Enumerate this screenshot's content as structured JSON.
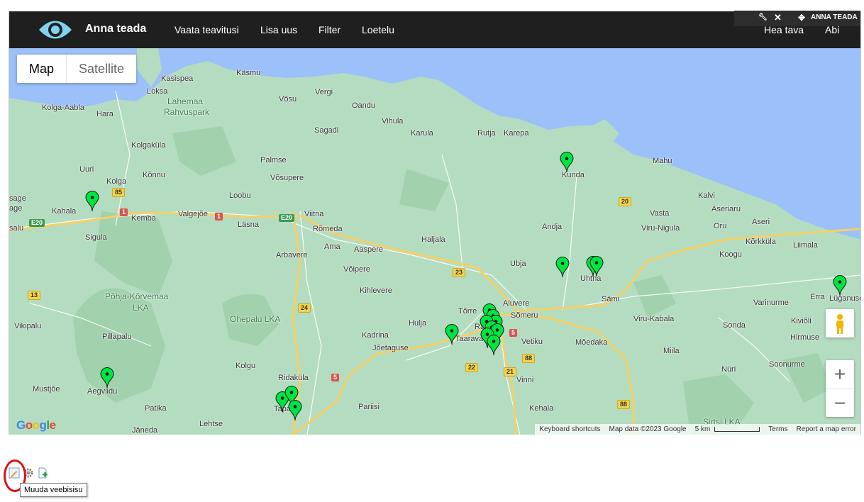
{
  "header": {
    "brand": "Anna teada",
    "nav": [
      "Vaata teavitusi",
      "Lisa uus",
      "Filter",
      "Loetelu"
    ],
    "nav_right": [
      "Hea tava",
      "Abi"
    ],
    "admin_label": "ANNA TEADA"
  },
  "map": {
    "type_map": "Map",
    "type_satellite": "Satellite",
    "places": [
      "Käsmu",
      "Kasispea",
      "Loksa",
      "Lahemaa",
      "Rahvuspark",
      "Vergi",
      "Võsu",
      "Oandu",
      "Kolga-Aabla",
      "Hara",
      "Vihula",
      "Sagadi",
      "Karula",
      "Rutja",
      "Karepa",
      "Kolgaküla",
      "Uuri",
      "Kõnnu",
      "Palmse",
      "Kunda",
      "Mahu",
      "Kolga",
      "Võsupere",
      "Loobu",
      "Kalvi",
      "Kahala",
      "Kemba",
      "Valgejõe",
      "Viitna",
      "Vasta",
      "Aseriaru",
      "Läsna",
      "Rõmeda",
      "Andja",
      "Viru-Nigula",
      "Oru",
      "Aseri",
      "Sigula",
      "Haljala",
      "Arbavere",
      "Ama",
      "Aaspere",
      "Kõrkküla",
      "Liimala",
      "Koogu",
      "Ubja",
      "Uhtna",
      "Võipere",
      "Põhja-Kõrvemaa",
      "LKA",
      "Kihlevere",
      "Sämi",
      "Ohepalu LKA",
      "Aluvere",
      "Erra",
      "Lüganuse",
      "Varinurme",
      "Tõrre",
      "Sõmeru",
      "Viru-Kabala",
      "Kiviõli",
      "Vikipalu",
      "Hulja",
      "Rakvere",
      "Sonda",
      "Kadrina",
      "Taarava",
      "Vetiku",
      "Mõedaka",
      "Hirmuse",
      "Pillapalu",
      "Jõetaguse",
      "Miila",
      "Kolgu",
      "Ridaküla",
      "Soonurme",
      "Vinni",
      "Nüri",
      "Aegviidu",
      "Mustjõe",
      "Tapa",
      "Pariisi",
      "Kehala",
      "Patika",
      "Lehtse",
      "Jäneda",
      "Sirtsi LKA",
      "sage",
      "salu",
      "age"
    ],
    "roads": [
      "E20",
      "E20",
      "85",
      "1",
      "1",
      "13",
      "24",
      "23",
      "5",
      "5",
      "20",
      "21",
      "22",
      "88",
      "88"
    ],
    "pins": 19,
    "footer": {
      "shortcuts": "Keyboard shortcuts",
      "data": "Map data ©2023 Google",
      "scale": "5 km",
      "terms": "Terms",
      "report": "Report a map error"
    },
    "google_logo": "Google"
  },
  "tooltip": "Muuda veebisisu",
  "colors": {
    "header_bg": "#1f1f1f",
    "land": "#b4dcc0",
    "water": "#9cc0f9",
    "pin": "#00e640",
    "highlight": "#dd1111"
  }
}
